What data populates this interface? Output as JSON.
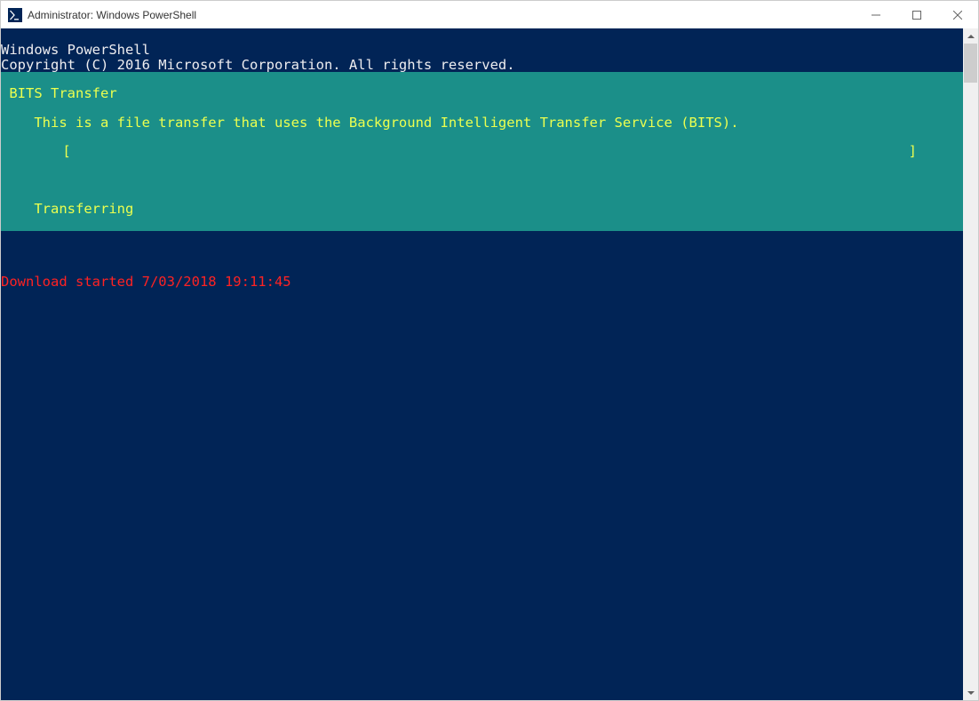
{
  "window": {
    "title": "Administrator: Windows PowerShell",
    "icon_name": "powershell-icon"
  },
  "console": {
    "header_line1": "Windows PowerShell",
    "header_line2": "Copyright (C) 2016 Microsoft Corporation. All rights reserved.",
    "progress": {
      "title": " BITS Transfer",
      "subtitle": "    This is a file transfer that uses the Background Intelligent Transfer Service (BITS).",
      "bar_left": "    [",
      "bar_right": "]",
      "status": "    Transferring"
    },
    "red_status": "Download started 7/03/2018 19:11:45"
  },
  "titlebar_buttons": {
    "minimize": "minimize",
    "maximize": "maximize",
    "close": "close"
  }
}
